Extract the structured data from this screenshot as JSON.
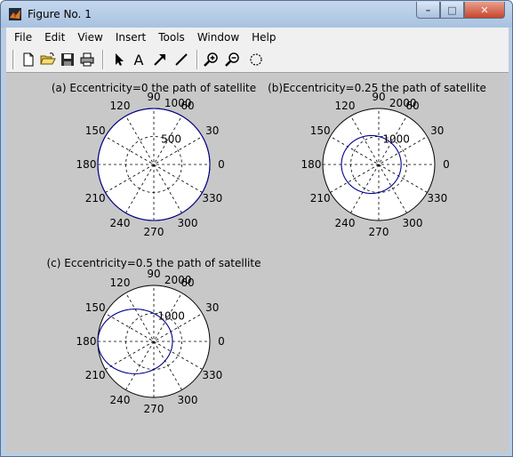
{
  "window": {
    "title": "Figure No. 1",
    "minimize_glyph": "–",
    "maximize_glyph": "□",
    "close_glyph": "✕"
  },
  "menu": [
    "File",
    "Edit",
    "View",
    "Insert",
    "Tools",
    "Window",
    "Help"
  ],
  "toolbar": [
    "new-figure-icon",
    "open-file-icon",
    "save-icon",
    "print-icon",
    "select-arrow-icon",
    "insert-text-icon",
    "insert-arrow-icon",
    "insert-line-icon",
    "zoom-in-icon",
    "zoom-out-icon",
    "rotate-3d-icon"
  ],
  "colors": {
    "curve": "#00008b",
    "grid": "#000000",
    "figure_bg": "#c8c8c8",
    "axes_bg": "#ffffff"
  },
  "chart_data": [
    {
      "type": "polar",
      "title": "(a) Eccentricity=0 the path of satellite",
      "rmax": 1000,
      "radial_ticks": [
        500,
        1000
      ],
      "angle_ticks": [
        0,
        30,
        60,
        90,
        120,
        150,
        180,
        210,
        240,
        270,
        300,
        330
      ],
      "series": [
        {
          "semi_latus": 1000,
          "eccentricity": 0
        }
      ]
    },
    {
      "type": "polar",
      "title": "(b)Eccentricity=0.25 the path of satellite",
      "rmax": 2000,
      "radial_ticks": [
        1000,
        2000
      ],
      "angle_ticks": [
        0,
        30,
        60,
        90,
        120,
        150,
        180,
        210,
        240,
        270,
        300,
        330
      ],
      "series": [
        {
          "semi_latus": 1000,
          "eccentricity": 0.25
        }
      ]
    },
    {
      "type": "polar",
      "title": "(c) Eccentricity=0.5 the path of satellite",
      "rmax": 2000,
      "radial_ticks": [
        1000,
        2000
      ],
      "angle_ticks": [
        0,
        30,
        60,
        90,
        120,
        150,
        180,
        210,
        240,
        270,
        300,
        330
      ],
      "series": [
        {
          "semi_latus": 1000,
          "eccentricity": 0.5
        }
      ]
    }
  ]
}
